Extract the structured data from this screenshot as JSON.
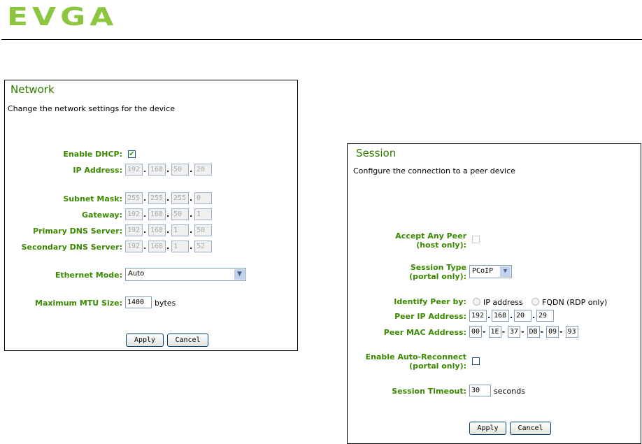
{
  "logo": "EVGA",
  "network": {
    "title": "Network",
    "description": "Change the network settings for the device",
    "dhcp_label": "Enable DHCP:",
    "dhcp_checked": true,
    "ip_label": "IP Address:",
    "ip": [
      "192",
      "168",
      "50",
      "20"
    ],
    "subnet_label": "Subnet Mask:",
    "subnet": [
      "255",
      "255",
      "255",
      "0"
    ],
    "gateway_label": "Gateway:",
    "gateway": [
      "192",
      "168",
      "50",
      "1"
    ],
    "dns1_label": "Primary DNS Server:",
    "dns1": [
      "192",
      "168",
      "1",
      "50"
    ],
    "dns2_label": "Secondary DNS Server:",
    "dns2": [
      "192",
      "168",
      "1",
      "52"
    ],
    "ethernet_label": "Ethernet Mode:",
    "ethernet_value": "Auto",
    "mtu_label": "Maximum MTU Size:",
    "mtu_value": "1400",
    "mtu_unit": "bytes",
    "apply": "Apply",
    "cancel": "Cancel"
  },
  "session": {
    "title": "Session",
    "description": "Configure the connection to a peer device",
    "accept_label1": "Accept Any Peer",
    "accept_label2": "(host only):",
    "type_label1": "Session Type",
    "type_label2": "(portal only):",
    "type_value": "PCoIP",
    "identify_label": "Identify Peer by:",
    "opt_ip": "IP address",
    "opt_fqdn": "FQDN (RDP only)",
    "peer_ip_label": "Peer IP Address:",
    "peer_ip": [
      "192",
      "168",
      "20",
      "29"
    ],
    "peer_mac_label": "Peer MAC Address:",
    "peer_mac": [
      "00",
      "1E",
      "37",
      "DB",
      "09",
      "93"
    ],
    "reconnect_label1": "Enable Auto-Reconnect",
    "reconnect_label2": "(portal only):",
    "timeout_label": "Session Timeout:",
    "timeout_value": "30",
    "timeout_unit": "seconds",
    "apply": "Apply",
    "cancel": "Cancel"
  }
}
